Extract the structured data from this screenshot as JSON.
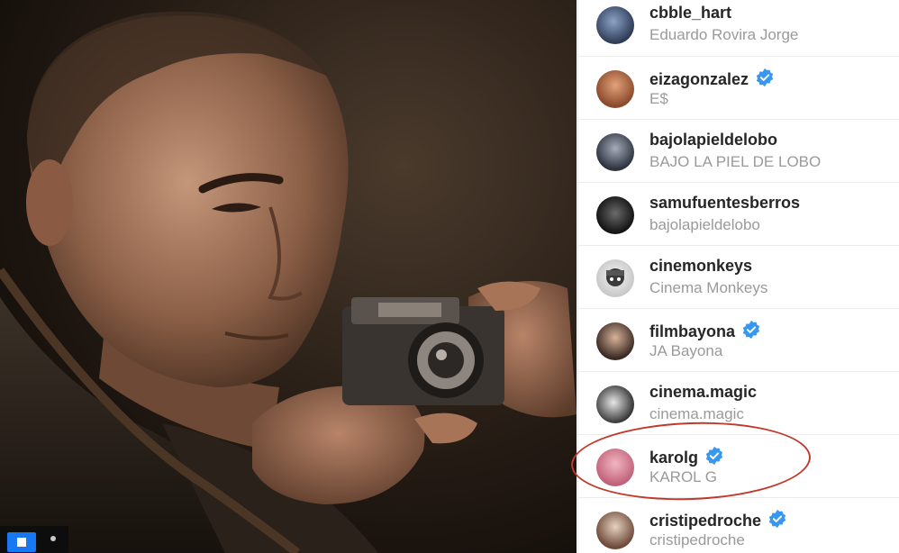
{
  "photo": {
    "alt_subject": "man holding camera"
  },
  "colors": {
    "verified": "#3897f0",
    "highlight_ring": "#c0392b",
    "username": "#262626",
    "fullname": "#9a9a9a"
  },
  "accounts": [
    {
      "username": "cbble_hart",
      "fullname": "Eduardo Rovira Jorge",
      "verified": false
    },
    {
      "username": "eizagonzalez",
      "fullname": "E$",
      "verified": true
    },
    {
      "username": "bajolapieldelobo",
      "fullname": "BAJO LA PIEL DE LOBO",
      "verified": false
    },
    {
      "username": "samufuentesberros",
      "fullname": "bajolapieldelobo",
      "verified": false
    },
    {
      "username": "cinemonkeys",
      "fullname": "Cinema Monkeys",
      "verified": false
    },
    {
      "username": "filmbayona",
      "fullname": "JA Bayona",
      "verified": true
    },
    {
      "username": "cinema.magic",
      "fullname": "cinema.magic",
      "verified": false
    },
    {
      "username": "karolg",
      "fullname": "KAROL G",
      "verified": true
    },
    {
      "username": "cristipedroche",
      "fullname": "cristipedroche",
      "verified": true
    }
  ]
}
